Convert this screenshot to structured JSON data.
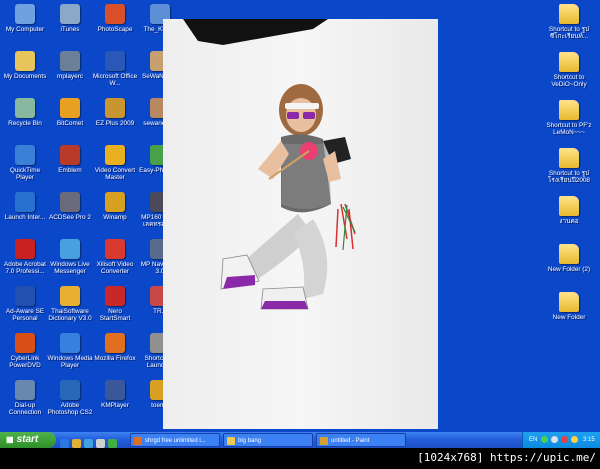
{
  "colors": {
    "desktop_bg": "#0a47c9",
    "taskbar": "#245edb",
    "start_green": "#3a9d35",
    "tray": "#0d8ae0"
  },
  "desktop_left_icons": [
    {
      "label": "My Computer",
      "icon": "computer-icon",
      "color": "#6fa0e0"
    },
    {
      "label": "iTunes",
      "icon": "itunes-icon",
      "color": "#8aa8c8"
    },
    {
      "label": "PhotoScape",
      "icon": "photoscape-icon",
      "color": "#d94f2a"
    },
    {
      "label": "The_KMP...",
      "icon": "kmplayer-icon",
      "color": "#5c8fd6"
    },
    {
      "label": "My Documents",
      "icon": "documents-icon",
      "color": "#e8c55a"
    },
    {
      "label": "mplayerc",
      "icon": "mplayerc-icon",
      "color": "#6c7f99"
    },
    {
      "label": "Microsoft Office W...",
      "icon": "word-icon",
      "color": "#2a58b8"
    },
    {
      "label": "SeWaNe#20",
      "icon": "image-file-icon",
      "color": "#c8a070"
    },
    {
      "label": "Recycle Bin",
      "icon": "recycle-bin-icon",
      "color": "#88b8a0"
    },
    {
      "label": "BitComet",
      "icon": "bitcomet-icon",
      "color": "#e8a020"
    },
    {
      "label": "EZ Plus 2009",
      "icon": "ezplus-icon",
      "color": "#c89530"
    },
    {
      "label": "sewane#2E",
      "icon": "image-file-icon",
      "color": "#b88860"
    },
    {
      "label": "QuickTime Player",
      "icon": "quicktime-icon",
      "color": "#3a80d8"
    },
    {
      "label": "Emblem",
      "icon": "emblem-icon",
      "color": "#b83a2a"
    },
    {
      "label": "Video Convert Master",
      "icon": "video-convert-icon",
      "color": "#e8b020"
    },
    {
      "label": "Easy-PhotoP...",
      "icon": "easyphoto-icon",
      "color": "#48a048"
    },
    {
      "label": "Launch Inter...",
      "icon": "internet-explorer-icon",
      "color": "#2a70d0"
    },
    {
      "label": "ACDSee Pro 2",
      "icon": "acdsee-icon",
      "color": "#6a6a7a"
    },
    {
      "label": "Winamp",
      "icon": "winamp-icon",
      "color": "#d8a020"
    },
    {
      "label": "MP160 ล็อกด์ เลคทรอนิกส์",
      "icon": "program-shortcut-icon",
      "color": "#4a4a5a"
    },
    {
      "label": "Adobe Acrobat 7.0 Professi...",
      "icon": "acrobat-icon",
      "color": "#c82020"
    },
    {
      "label": "Windows Live Messenger",
      "icon": "messenger-icon",
      "color": "#48a0e0"
    },
    {
      "label": "Xilisoft Video Converter",
      "icon": "xilisoft-icon",
      "color": "#d83a30"
    },
    {
      "label": "MP Navigator 3.0",
      "icon": "mp-navigator-icon",
      "color": "#5a6a8a"
    },
    {
      "label": "Ad-Aware SE Personal",
      "icon": "adaware-icon",
      "color": "#2050b0"
    },
    {
      "label": "ThaiSoftware Dictionary V3.0",
      "icon": "dictionary-icon",
      "color": "#e8b030"
    },
    {
      "label": "Nero StartSmart",
      "icon": "nero-icon",
      "color": "#c82828"
    },
    {
      "label": "TR...",
      "icon": "tr-program-icon",
      "color": "#c84848"
    },
    {
      "label": "CyberLink PowerDVD",
      "icon": "powerdvd-icon",
      "color": "#d85018"
    },
    {
      "label": "Windows Media Player",
      "icon": "media-player-icon",
      "color": "#3880e0"
    },
    {
      "label": "Mozilla Firefox",
      "icon": "firefox-icon",
      "color": "#e07020"
    },
    {
      "label": "Shortcut to Launcher",
      "icon": "launcher-icon",
      "color": "#909090"
    },
    {
      "label": "Dial-up Connection",
      "icon": "dialup-icon",
      "color": "#6888b0"
    },
    {
      "label": "Adobe Photoshop CS2",
      "icon": "photoshop-icon",
      "color": "#2868b8"
    },
    {
      "label": "KMPlayer",
      "icon": "kmplayer-icon",
      "color": "#3a5898"
    },
    {
      "label": "toemu",
      "icon": "toemu-icon",
      "color": "#d8a020"
    }
  ],
  "desktop_right_icons": [
    {
      "label": "Shortcut to รูป ซีโกะเรียนท์...",
      "icon": "folder-icon"
    },
    {
      "label": "Shortcut to VeDiO~Only",
      "icon": "folder-icon"
    },
    {
      "label": "Shortcut to PF'z LeMoN~~~",
      "icon": "folder-icon"
    },
    {
      "label": "Shortcut to รูป โรงเรียนปี2008",
      "icon": "folder-icon"
    },
    {
      "label": "งานคอ",
      "icon": "folder-icon"
    },
    {
      "label": "New Folder (2)",
      "icon": "folder-icon"
    },
    {
      "label": "New Folder",
      "icon": "folder-icon"
    }
  ],
  "taskbar": {
    "start_label": "start",
    "quicklaunch": [
      {
        "icon": "ie-quicklaunch-icon",
        "color": "#2a78e0"
      },
      {
        "icon": "outlook-quicklaunch-icon",
        "color": "#e0b030"
      },
      {
        "icon": "media-quicklaunch-icon",
        "color": "#40a0e0"
      },
      {
        "icon": "show-desktop-icon",
        "color": "#d0d0d0"
      },
      {
        "icon": "messenger-quicklaunch-icon",
        "color": "#40b040"
      }
    ],
    "tasks": [
      {
        "label": "shrgd free unlimited i...",
        "icon": "firefox-task-icon",
        "color": "#e07020"
      },
      {
        "label": "big bang",
        "icon": "folder-task-icon",
        "color": "#f0c850"
      },
      {
        "label": "untitled - Paint",
        "icon": "paint-task-icon",
        "color": "#d8a030"
      }
    ],
    "tray": {
      "lang": "EN",
      "time": "3:15"
    }
  },
  "caption": "[1024x768] https://upic.me/"
}
